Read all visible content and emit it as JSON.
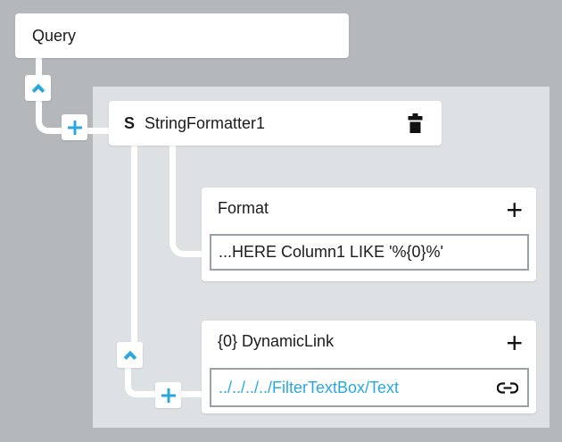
{
  "diagram": {
    "query": {
      "label": "Query"
    },
    "string_formatter": {
      "type_badge": "S",
      "name": "StringFormatter1"
    },
    "format": {
      "label": "Format",
      "add_label": "+",
      "value": "...HERE Column1 LIKE '%{0}%'"
    },
    "dynamic_link": {
      "label": "{0} DynamicLink",
      "add_label": "+",
      "value": "../../../../FilterTextBox/Text"
    }
  },
  "icons": {
    "collapse": "chevron-up-icon",
    "add_node": "plus-icon",
    "delete": "trash-icon",
    "binding": "link-icon"
  },
  "colors": {
    "canvas_background": "#b4b8bb",
    "group_panel": "#dee1e3",
    "node_background": "#ffffff",
    "accent_blue": "#29a8e0",
    "text": "#1b1b1b",
    "field_border": "#9aa0a4",
    "icon_black": "#111111"
  }
}
